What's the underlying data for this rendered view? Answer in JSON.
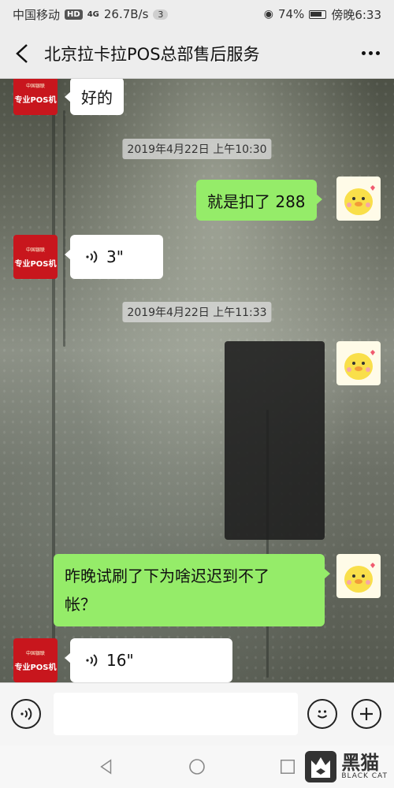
{
  "status_bar": {
    "carrier": "中国移动",
    "hd_badge": "HD",
    "network": "4G",
    "speed": "26.7B/s",
    "notif_count": "3",
    "battery": "74%",
    "time": "傍晚6:33"
  },
  "header": {
    "title": "北京拉卡拉POS总部售后服务"
  },
  "avatars": {
    "brand_top": "中国银联",
    "brand_bottom": "专业POS机"
  },
  "messages": [
    {
      "side": "left",
      "type": "text",
      "text": "好的"
    },
    {
      "type": "timestamp",
      "text": "2019年4月22日 上午10:30"
    },
    {
      "side": "right",
      "type": "text",
      "text": "就是扣了 288"
    },
    {
      "side": "left",
      "type": "voice",
      "duration": "3\""
    },
    {
      "type": "timestamp",
      "text": "2019年4月22日 上午11:33"
    },
    {
      "side": "right",
      "type": "image",
      "text": ""
    },
    {
      "side": "right",
      "type": "text",
      "text_line1": "昨晚试刷了下为啥迟迟到不了",
      "text_line2": "帐？"
    },
    {
      "side": "left",
      "type": "voice",
      "duration": "16\""
    }
  ],
  "input": {
    "placeholder": "",
    "value": ""
  },
  "watermark": {
    "cn": "黑猫",
    "en": "BLACK CAT"
  },
  "colors": {
    "sent_bubble": "#95ec69",
    "received_bubble": "#ffffff",
    "brand_red": "#c8161d"
  }
}
